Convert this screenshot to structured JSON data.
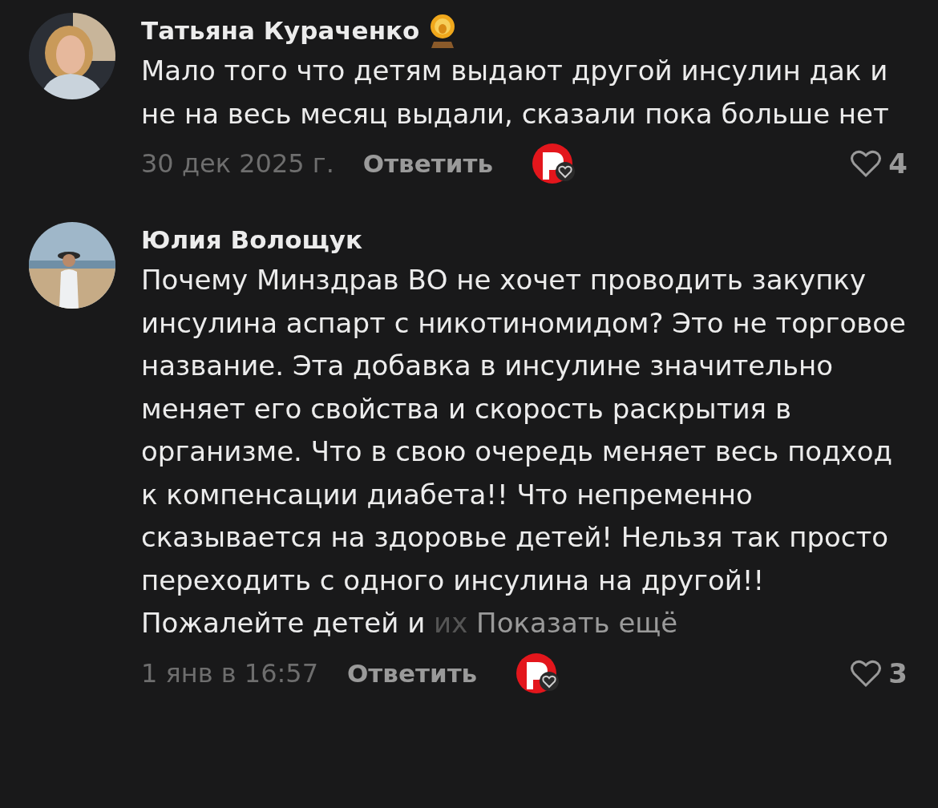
{
  "comments": [
    {
      "author": "Татьяна Кураченко",
      "badge": true,
      "text": "Мало того что детям выдают другой инсулин дак и не на весь месяц выдали, сказали пока больше нет",
      "date": "30 дек 2025 г.",
      "reply": "Ответить",
      "likes": "4"
    },
    {
      "author": "Юлия Волощук",
      "badge": false,
      "text": "Почему Минздрав ВО не хочет проводить закупку инсулина аспарт с никотиномидом? Это не торговое название. Эта добавка в инсулине значительно меняет его свойства и скорость раскрытия в организме. Что в свою очередь меняет весь подход к компенсации диабета!! Что непременно сказывается на здоровье детей! Нельзя так просто переходить с одного инсулина на другой!! Пожалейте детей и",
      "fade_tail": "их",
      "more": "Показать ещё",
      "date": "1 янв в 16:57",
      "reply": "Ответить",
      "likes": "3"
    }
  ]
}
